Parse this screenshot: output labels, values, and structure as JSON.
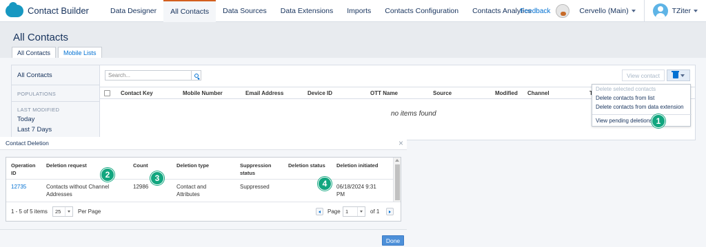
{
  "app": {
    "brand": "Contact Builder"
  },
  "nav": {
    "tabs": [
      "Data Designer",
      "All Contacts",
      "Data Sources",
      "Data Extensions",
      "Imports",
      "Contacts Configuration",
      "Contacts Analytics"
    ],
    "active_tab": "All Contacts",
    "feedback": "Feedback",
    "business_unit": "Cervello (Main)",
    "user": "TZiter"
  },
  "page": {
    "title": "All Contacts",
    "subtabs": [
      "All Contacts",
      "Mobile Lists"
    ]
  },
  "leftnav": {
    "all_contacts": "All Contacts",
    "populations": "POPULATIONS",
    "last_modified": "LAST MODIFIED",
    "today": "Today",
    "last7": "Last 7 Days"
  },
  "toolbar": {
    "search_placeholder": "Search...",
    "view_contact": "View contact"
  },
  "table": {
    "columns": [
      "Contact Key",
      "Mobile Number",
      "Email Address",
      "Device ID",
      "OTT Name",
      "Source",
      "Modified",
      "Channel",
      "T"
    ],
    "empty": "no items found"
  },
  "delete_menu": {
    "items": [
      "Delete selected contacts",
      "Delete contacts from list",
      "Delete contacts from data extension",
      "View pending deletions"
    ]
  },
  "callouts": [
    "1",
    "2",
    "3",
    "4"
  ],
  "modal": {
    "title": "Contact Deletion",
    "close": "×",
    "columns": {
      "op_id": [
        "Operation",
        "ID"
      ],
      "request": "Deletion request",
      "count": "Count",
      "type": "Deletion type",
      "suppression": [
        "Suppression",
        "status"
      ],
      "status": "Deletion status",
      "initiated": "Deletion initiated"
    },
    "row": {
      "op_id": "12735",
      "request": [
        "Contacts without Channel",
        "Addresses"
      ],
      "count": "12986",
      "type": [
        "Contact and",
        "Attributes"
      ],
      "suppression": "Suppressed",
      "status": "",
      "initiated": [
        "06/18/2024 9:31",
        "PM"
      ]
    },
    "pager": {
      "summary": "1 - 5 of 5 items",
      "page_size": "25",
      "per_page": "Per Page",
      "page_label": "Page",
      "page": "1",
      "of": "of 1"
    },
    "done": "Done"
  },
  "colors": {
    "accent": "#0070d2",
    "callout": "#12a67f",
    "active_tab_border": "#d35f1e"
  }
}
